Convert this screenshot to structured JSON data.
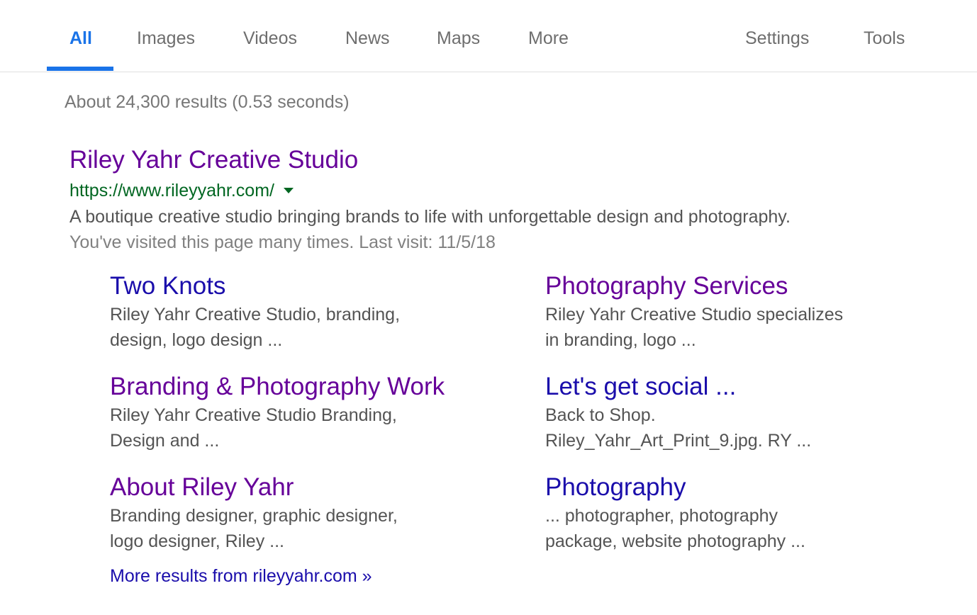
{
  "nav": {
    "tabs": [
      {
        "label": "All",
        "active": true
      },
      {
        "label": "Images",
        "active": false
      },
      {
        "label": "Videos",
        "active": false
      },
      {
        "label": "News",
        "active": false
      },
      {
        "label": "Maps",
        "active": false
      },
      {
        "label": "More",
        "active": false
      }
    ],
    "settings_label": "Settings",
    "tools_label": "Tools"
  },
  "stats": "About 24,300 results (0.53 seconds)",
  "result": {
    "title": "Riley Yahr Creative Studio",
    "url": "https://www.rileyyahr.com/",
    "url_menu_icon": "dropdown-caret-icon",
    "snippet": "A boutique creative studio bringing brands to life with unforgettable design and photography.",
    "visited_note": "You've visited this page many times. Last visit: 11/5/18"
  },
  "sitelinks": [
    {
      "title": "Two Knots",
      "visited": false,
      "desc_lines": [
        "Riley Yahr Creative Studio, branding,",
        "design, logo design ..."
      ]
    },
    {
      "title": "Photography Services",
      "visited": true,
      "desc_lines": [
        "Riley Yahr Creative Studio specializes",
        "in branding, logo ..."
      ]
    },
    {
      "title": "Branding & Photography Work",
      "visited": true,
      "desc_lines": [
        "Riley Yahr Creative Studio Branding,",
        "Design and ..."
      ]
    },
    {
      "title": "Let's get social ...",
      "visited": false,
      "desc_lines": [
        "Back to Shop.",
        "Riley_Yahr_Art_Print_9.jpg. RY ..."
      ]
    },
    {
      "title": "About Riley Yahr",
      "visited": true,
      "desc_lines": [
        "Branding designer, graphic designer,",
        "logo designer, Riley ..."
      ]
    },
    {
      "title": "Photography",
      "visited": false,
      "desc_lines": [
        "... photographer, photography",
        "package, website photography ..."
      ]
    }
  ],
  "more_results": "More results from rileyyahr.com »",
  "colors": {
    "accent": "#1a73e8",
    "visited_link": "#660099",
    "unvisited_link": "#1a0dab",
    "url_green": "#006621"
  }
}
